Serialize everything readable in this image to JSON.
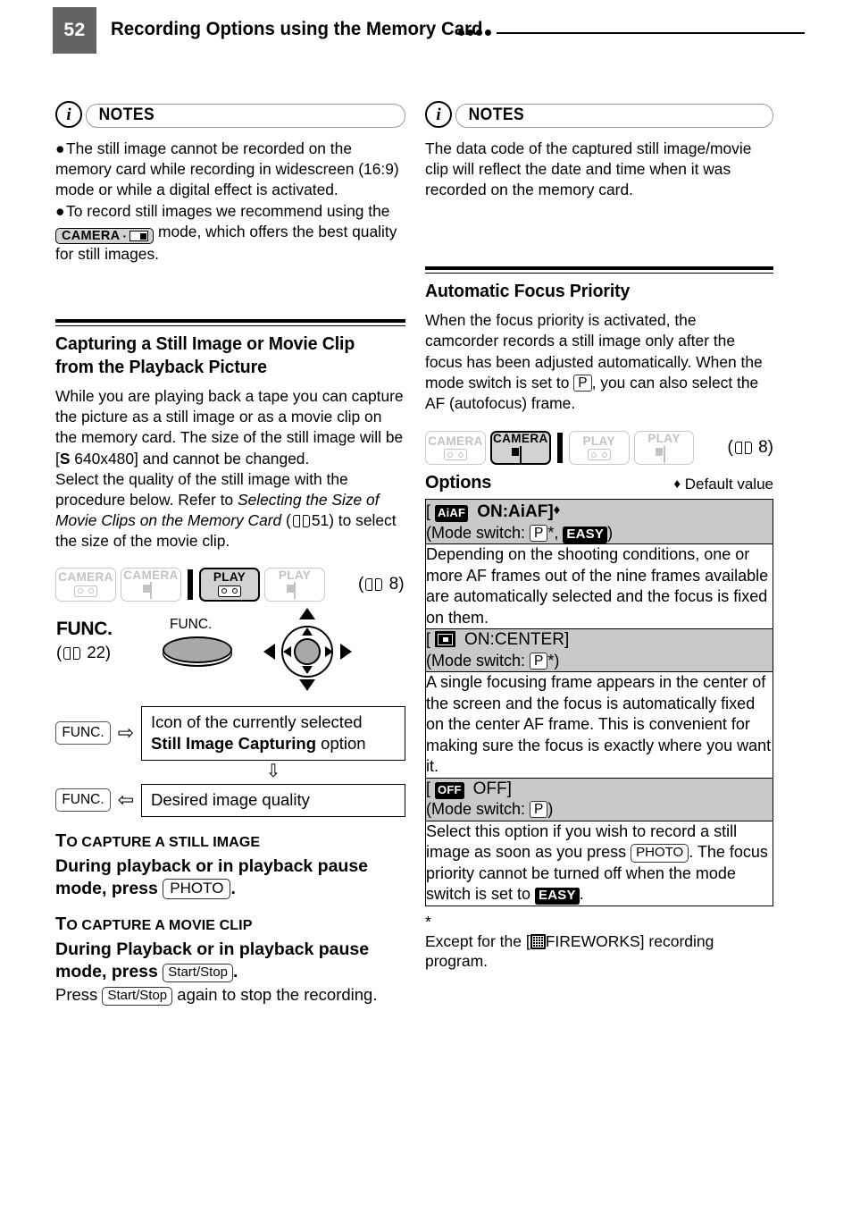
{
  "header": {
    "page_number": "52",
    "title": "Recording Options using the Memory Card",
    "dots_count": 4
  },
  "left_column": {
    "notes": {
      "label": "NOTES",
      "icon": "i",
      "bullets": [
        "The still image cannot be recorded on the memory card while recording in widescreen (16:9) mode or while a digital effect is activated.",
        "To record still images we recommend using the"
      ],
      "bullet2_chip": "CAMERA",
      "bullet2_tail": "mode, which offers the best quality for still images."
    },
    "section": {
      "heading": "Capturing a Still Image or Movie Clip from the Playback Picture",
      "para1_a": "While you are playing back a tape you can capture the picture as a still image or as a movie clip on the memory card. The size of the still image will be [",
      "para1_s": "S",
      "para1_b": " 640x480] and cannot be changed.",
      "para2_a": "Select the quality of the still image with the procedure below. Refer to ",
      "para2_italic": "Selecting the Size of Movie Clips on the Memory Card",
      "para2_ref_open": " (",
      "para2_ref_page": "51",
      "para2_b": ") to select the size of the movie clip."
    },
    "mode_badges": [
      {
        "label": "CAMERA",
        "icon": "tape-icon",
        "active": false
      },
      {
        "label": "CAMERA",
        "icon": "card-icon",
        "active": false
      },
      {
        "label": "PLAY",
        "icon": "tape-icon",
        "active": true
      },
      {
        "label": "PLAY",
        "icon": "card-icon",
        "active": false
      }
    ],
    "mode_ref_page": "8",
    "func_diagram": {
      "title": "FUNC.",
      "ref_page": "22",
      "button_caption": "FUNC.",
      "steps": [
        {
          "key": "FUNC.",
          "arrow": "right",
          "text_a": "Icon of the currently selected ",
          "text_bold": "Still Image Capturing",
          "text_b": " option"
        },
        {
          "key": "FUNC.",
          "arrow": "left",
          "text_a": "Desired image quality",
          "text_bold": "",
          "text_b": ""
        }
      ]
    },
    "procedures": [
      {
        "heading_first": "T",
        "heading_rest": "O CAPTURE A STILL IMAGE",
        "bold_a": "During playback or in playback pause mode, press ",
        "key": "PHOTO",
        "bold_b": ".",
        "plain": ""
      },
      {
        "heading_first": "T",
        "heading_rest": "O CAPTURE A MOVIE CLIP",
        "bold_a": "During Playback or in playback pause mode, press ",
        "key": "Start/Stop",
        "bold_b": ".",
        "plain_a": "Press ",
        "plain_key": "Start/Stop",
        "plain_b": " again to stop the recording."
      }
    ]
  },
  "right_column": {
    "notes": {
      "label": "NOTES",
      "icon": "i",
      "text": "The data code of the captured still image/movie clip will reflect the date and time when it was recorded on the memory card."
    },
    "section": {
      "heading": "Automatic Focus Priority",
      "para_a": "When the focus priority is activated, the camcorder records a still image only after the focus has been adjusted automatically. When the mode switch is set to ",
      "para_p": "P",
      "para_b": ", you can also select the AF (autofocus) frame."
    },
    "mode_badges": [
      {
        "label": "CAMERA",
        "icon": "tape-icon",
        "active": false
      },
      {
        "label": "CAMERA",
        "icon": "card-icon",
        "active": true
      },
      {
        "label": "PLAY",
        "icon": "tape-icon",
        "active": false
      },
      {
        "label": "PLAY",
        "icon": "card-icon",
        "active": false
      }
    ],
    "mode_ref_page": "8",
    "options_label": "Options",
    "default_value_label": "Default value",
    "default_value_marker": "♦",
    "options_table": [
      {
        "icon": "aiaf-icon",
        "icon_text": "AiAF",
        "name": "ON:AiAF]",
        "name_open": "[",
        "default_marker": "♦",
        "mode_switch_a": "(Mode switch: ",
        "mode_switch_p": "P",
        "mode_switch_star": "*,",
        "mode_switch_easy": "EASY",
        "mode_switch_b": ")",
        "description": "Depending on the shooting conditions, one or more AF frames out of the nine frames available are automatically selected and the focus is fixed on them."
      },
      {
        "icon": "af-center-icon",
        "icon_text": "",
        "name": "ON:CENTER]",
        "name_open": "[",
        "default_marker": "",
        "mode_switch_a": "(Mode switch: ",
        "mode_switch_p": "P",
        "mode_switch_star": "*",
        "mode_switch_easy": "",
        "mode_switch_b": ")",
        "description": "A single focusing frame appears in the center of the screen and the focus is automatically fixed on the center AF frame. This is convenient for making sure the focus is exactly where you want it."
      },
      {
        "icon": "off-icon",
        "icon_text": "OFF",
        "name": "OFF]",
        "name_open": "[",
        "default_marker": "",
        "mode_switch_a": "(Mode switch: ",
        "mode_switch_p": "P",
        "mode_switch_star": "",
        "mode_switch_easy": "",
        "mode_switch_b": ")",
        "description_a": "Select this option if you wish to record a still image as soon as you press ",
        "description_key": "PHOTO",
        "description_b": ". The focus priority cannot be turned off when the mode switch is set to ",
        "description_easy": "EASY",
        "description_c": "."
      }
    ],
    "footnote": {
      "marker": "*",
      "text_a": "Except for the [",
      "icon": "fireworks-icon",
      "text_b": "FIREWORKS] recording program."
    }
  }
}
